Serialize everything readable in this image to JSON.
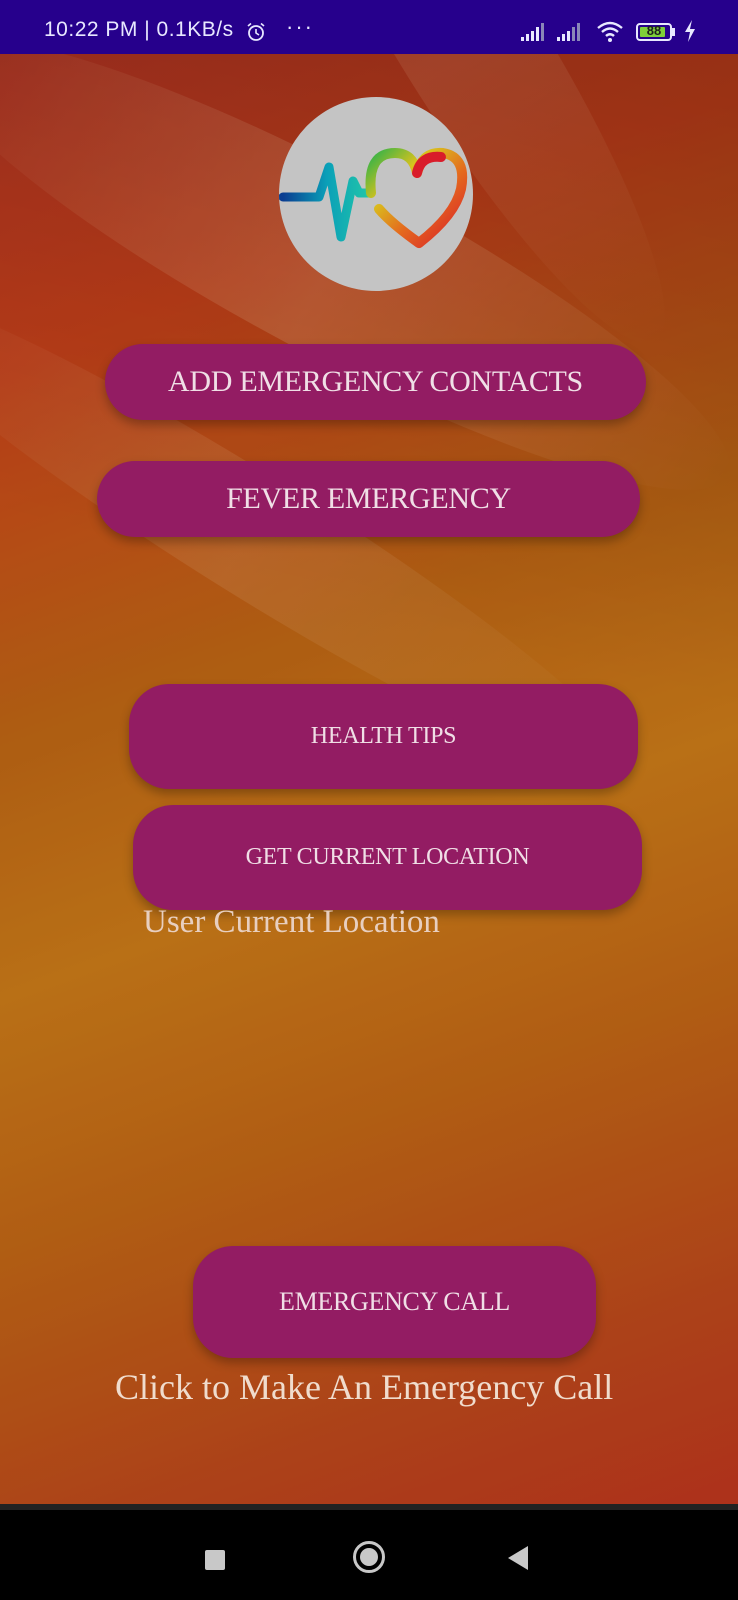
{
  "status_bar": {
    "time": "10:22 PM",
    "separator": "|",
    "net_speed": "0.1KB/s",
    "alarm_icon": "alarm-clock-icon",
    "more_icon": "more-dots-icon",
    "more_text": "···",
    "signal_icons": [
      "signal-icon",
      "signal-icon"
    ],
    "wifi_icon": "wifi-icon",
    "battery_level": "88",
    "battery_fraction": 0.88,
    "charging_icon": "charging-bolt-icon",
    "background_color": "#26008c"
  },
  "app": {
    "logo_icon": "heartbeat-heart-logo",
    "buttons": {
      "add_contacts": "ADD EMERGENCY CONTACTS",
      "fever": "FEVER EMERGENCY",
      "health_tips": "HEALTH TIPS",
      "get_location": "GET CURRENT LOCATION",
      "emergency_call": "EMERGENCY CALL"
    },
    "location_text": "User Current Location",
    "call_caption": "Click to Make An Emergency Call",
    "button_color": "#931c63"
  },
  "nav_bar": {
    "recents_icon": "square-recents-icon",
    "home_icon": "circle-home-icon",
    "back_icon": "triangle-back-icon"
  }
}
